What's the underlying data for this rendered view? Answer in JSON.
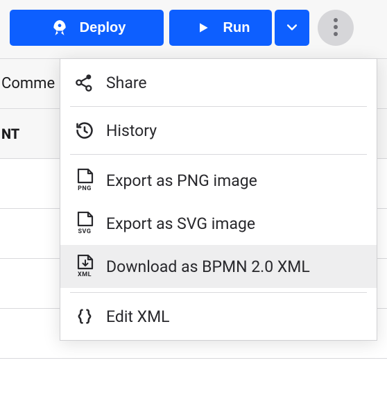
{
  "toolbar": {
    "deploy_label": "Deploy",
    "run_label": "Run"
  },
  "background": {
    "header1": "Comme",
    "header2": "NT"
  },
  "menu": {
    "share": "Share",
    "history": "History",
    "export_png": "Export as PNG image",
    "export_svg": "Export as SVG image",
    "download_bpmn": "Download as BPMN 2.0 XML",
    "edit_xml": "Edit XML",
    "png_badge": "PNG",
    "svg_badge": "SVG",
    "xml_badge": "XML"
  }
}
